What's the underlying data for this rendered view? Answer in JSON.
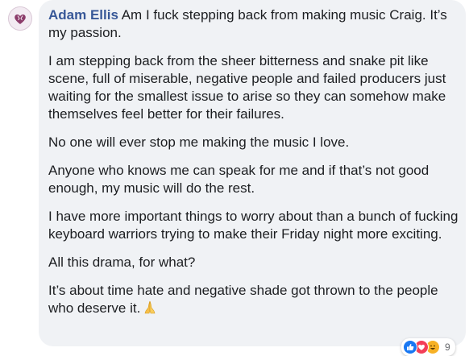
{
  "comment": {
    "author": "Adam Ellis",
    "paragraphs": [
      "Am I fuck stepping back from making music Craig. It’s my passion.",
      "I am stepping back from the sheer bitterness and snake pit like scene, full of miserable, negative people and failed producers just waiting for the smallest issue to arise so they can somehow make themselves feel better for their failures.",
      "No one will ever stop me making the music I love.",
      "Anyone who knows me can speak for me and if that’s not good enough, my music will do the rest.",
      "I have more important things to worry about than a bunch of fucking keyboard warriors trying to make their Friday night more exciting.",
      "All this drama, for what?",
      "It’s about time hate and negative shade got thrown to the people who deserve it."
    ],
    "closing_emoji": "praying-hands-emoji"
  },
  "reactions": {
    "types": [
      "like",
      "love",
      "haha"
    ],
    "count": "9"
  },
  "colors": {
    "author": "#385898",
    "bubble": "#f0f2f5",
    "text": "#1c1e21",
    "like": "#1877f2",
    "love": "#f33e58",
    "haha": "#f7b125"
  }
}
